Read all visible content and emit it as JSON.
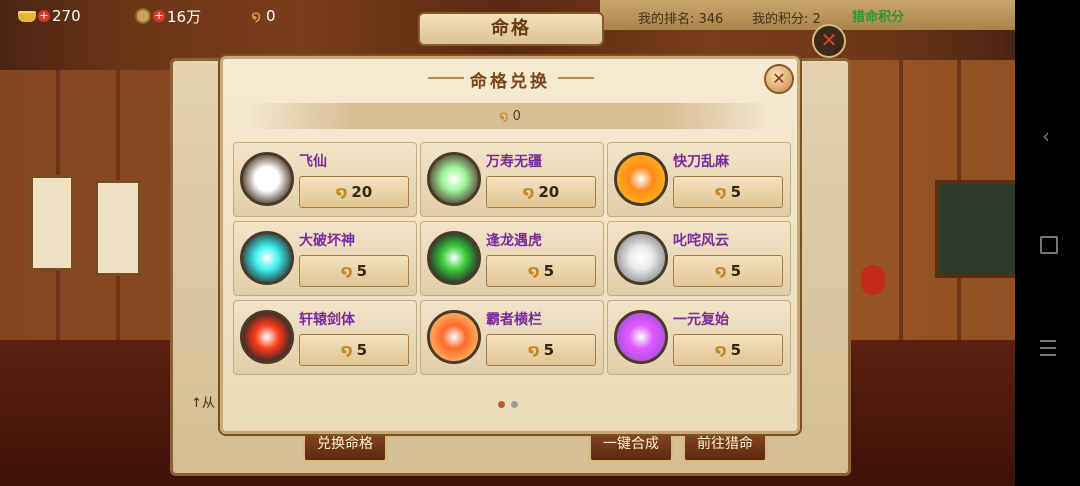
{
  "hud": {
    "gold": "270",
    "coins": "16万",
    "spirit": "0",
    "title": "命格",
    "rank": "我的排名: 346",
    "score": "我的积分: 2",
    "hunt": "猎命积分"
  },
  "background": {
    "hint": "↑从",
    "buttons": {
      "exchange": "兑换命格",
      "synthesize": "一键合成",
      "goto_hunt": "前往猎命"
    }
  },
  "modal": {
    "title": "命格兑换",
    "balance": "0",
    "items": [
      {
        "name": "飞仙",
        "price": "20",
        "color": "#ffffff",
        "ring": "#5a4a3a"
      },
      {
        "name": "万寿无疆",
        "price": "20",
        "color": "#9ef59a",
        "ring": "#5a5040"
      },
      {
        "name": "快刀乱麻",
        "price": "5",
        "color": "#ff8a1a",
        "ring": "#ffb020"
      },
      {
        "name": "大破坏神",
        "price": "5",
        "color": "#3ef0f0",
        "ring": "#2a4a4a"
      },
      {
        "name": "逢龙遇虎",
        "price": "5",
        "color": "#3acd3a",
        "ring": "#2a3a2a"
      },
      {
        "name": "叱咤风云",
        "price": "5",
        "color": "#e8e8e8",
        "ring": "#9a9a9a"
      },
      {
        "name": "轩辕剑体",
        "price": "5",
        "color": "#ff3a1a",
        "ring": "#3a2a2a"
      },
      {
        "name": "霸者横栏",
        "price": "5",
        "color": "#ff6a2a",
        "ring": "#ffb060"
      },
      {
        "name": "一元复始",
        "price": "5",
        "color": "#e05aff",
        "ring": "#b050e0"
      }
    ],
    "page_indicator": {
      "current": 1,
      "total": 2
    }
  },
  "colors": {
    "accent": "#7a4418",
    "item_name": "#7a2aa0"
  }
}
